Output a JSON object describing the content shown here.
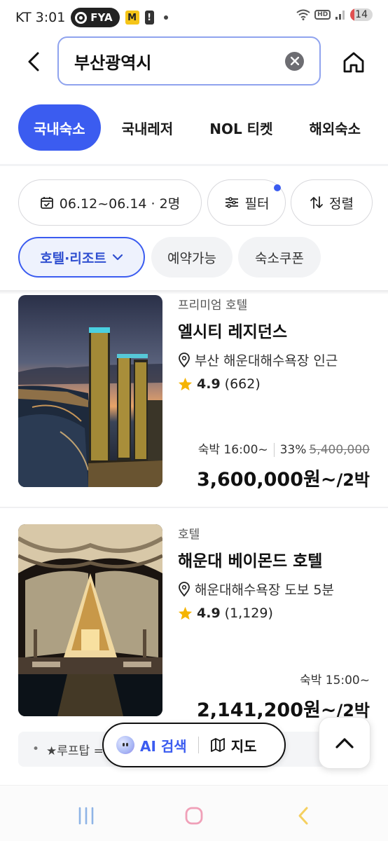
{
  "status_bar": {
    "carrier_time": "KT 3:01",
    "fya_label": "FYA",
    "m_label": "M",
    "alert_label": "!",
    "hd_label": "HD",
    "battery": "14"
  },
  "search": {
    "value": "부산광역시"
  },
  "category_tabs": [
    {
      "label": "국내숙소",
      "active": true
    },
    {
      "label": "국내레저",
      "active": false
    },
    {
      "label": "NOL 티켓",
      "active": false
    },
    {
      "label": "해외숙소",
      "active": false
    }
  ],
  "filters": {
    "date_guests": "06.12~06.14 · 2명",
    "filter_label": "필터",
    "sort_label": "정렬"
  },
  "tags": {
    "type_label": "호텔·리조트",
    "available_label": "예약가능",
    "coupon_label": "숙소쿠폰"
  },
  "listings": [
    {
      "category": "프리미엄 호텔",
      "name": "엘시티 레지던스",
      "location": "부산 해운대해수욕장 인근",
      "rating": "4.9",
      "reviews": "(662)",
      "checkin": "숙박 16:00~",
      "discount": "33%",
      "original_price": "5,400,000",
      "price": "3,600,000원~",
      "nights": "/2박"
    },
    {
      "category": "호텔",
      "name": "해운대 베이몬드 호텔",
      "location": "해운대해수욕장 도보 5분",
      "rating": "4.9",
      "reviews": "(1,129)",
      "checkin": "숙박 15:00~",
      "price": "2,141,200원~",
      "nights": "/2박"
    }
  ],
  "banner": {
    "bullet": "•",
    "text": "★루프탑 ="
  },
  "floating": {
    "ai_label": "AI 검색",
    "map_label": "지도"
  },
  "colors": {
    "accent": "#3b5cf0",
    "star": "#f5b400"
  }
}
